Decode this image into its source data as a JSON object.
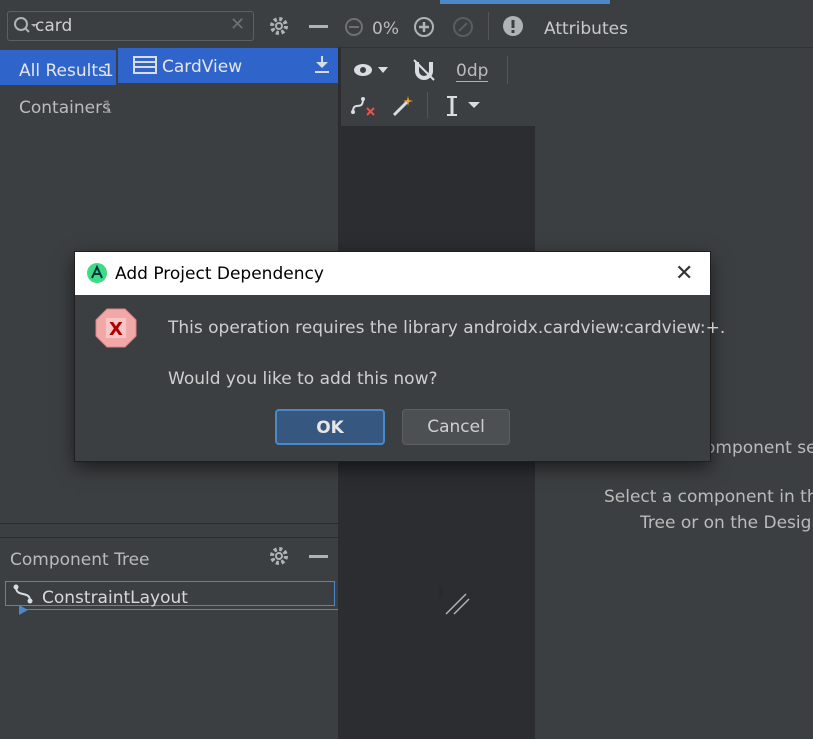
{
  "palette": {
    "search_value": "card",
    "tabs": [
      {
        "label": "All Results",
        "count": "1"
      },
      {
        "label": "Containers",
        "count": "1"
      }
    ],
    "result_item": "CardView"
  },
  "toolbar": {
    "zoom_level": "0%",
    "margin_value": "0dp"
  },
  "attributes": {
    "header": "Attributes",
    "empty_partial": "omponent se",
    "hint_line1": "Select a component in the",
    "hint_line2": "Tree or on the Design"
  },
  "component_tree": {
    "header": "Component Tree",
    "root": "ConstraintLayout"
  },
  "dialog": {
    "title": "Add Project Dependency",
    "message": "This operation requires the library androidx.cardview:cardview:+.",
    "question": "Would you like to add this now?",
    "ok_label": "OK",
    "cancel_label": "Cancel"
  }
}
